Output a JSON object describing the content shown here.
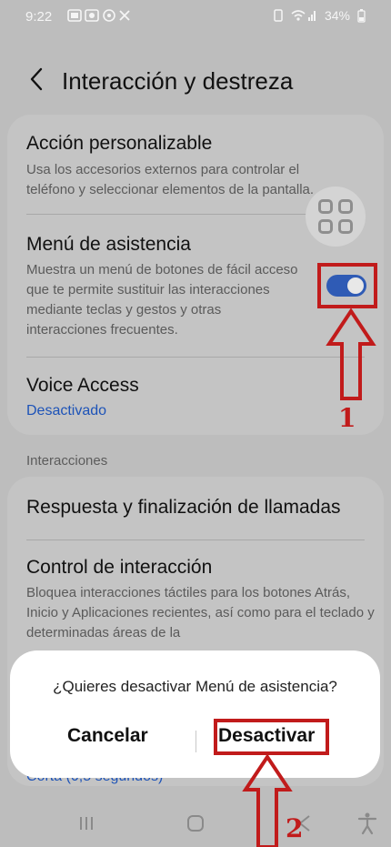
{
  "status_bar": {
    "time": "9:22",
    "battery": "34%"
  },
  "header": {
    "title": "Interacción y destreza"
  },
  "rows": [
    {
      "title": "Acción personalizable",
      "description": "Usa los accesorios externos para controlar el teléfono y seleccionar elementos de la pantalla."
    },
    {
      "title": "Menú de asistencia",
      "description": "Muestra un menú de botones de fácil acceso que te permite sustituir las interacciones mediante teclas y gestos y otras interacciones frecuentes.",
      "toggle_on": true
    },
    {
      "title": "Voice Access",
      "status": "Desactivado"
    }
  ],
  "section": {
    "label": "Interacciones"
  },
  "rows2": [
    {
      "title": "Respuesta y finalización de llamadas"
    },
    {
      "title": "Control de interacción",
      "description": "Bloquea interacciones táctiles para los botones Atrás, Inicio y Aplicaciones recientes, así como para el teclado y determinadas áreas de la"
    },
    {
      "status": "Corta (0,5 segundos)"
    }
  ],
  "dialog": {
    "message": "¿Quieres desactivar Menú de asistencia?",
    "cancel_label": "Cancelar",
    "confirm_label": "Desactivar"
  },
  "annotations": {
    "step1": "1",
    "step2": "2",
    "color": "#c11b1b"
  },
  "colors": {
    "toggle_on": "#2f5bb5",
    "link_blue": "#1d53b8"
  }
}
